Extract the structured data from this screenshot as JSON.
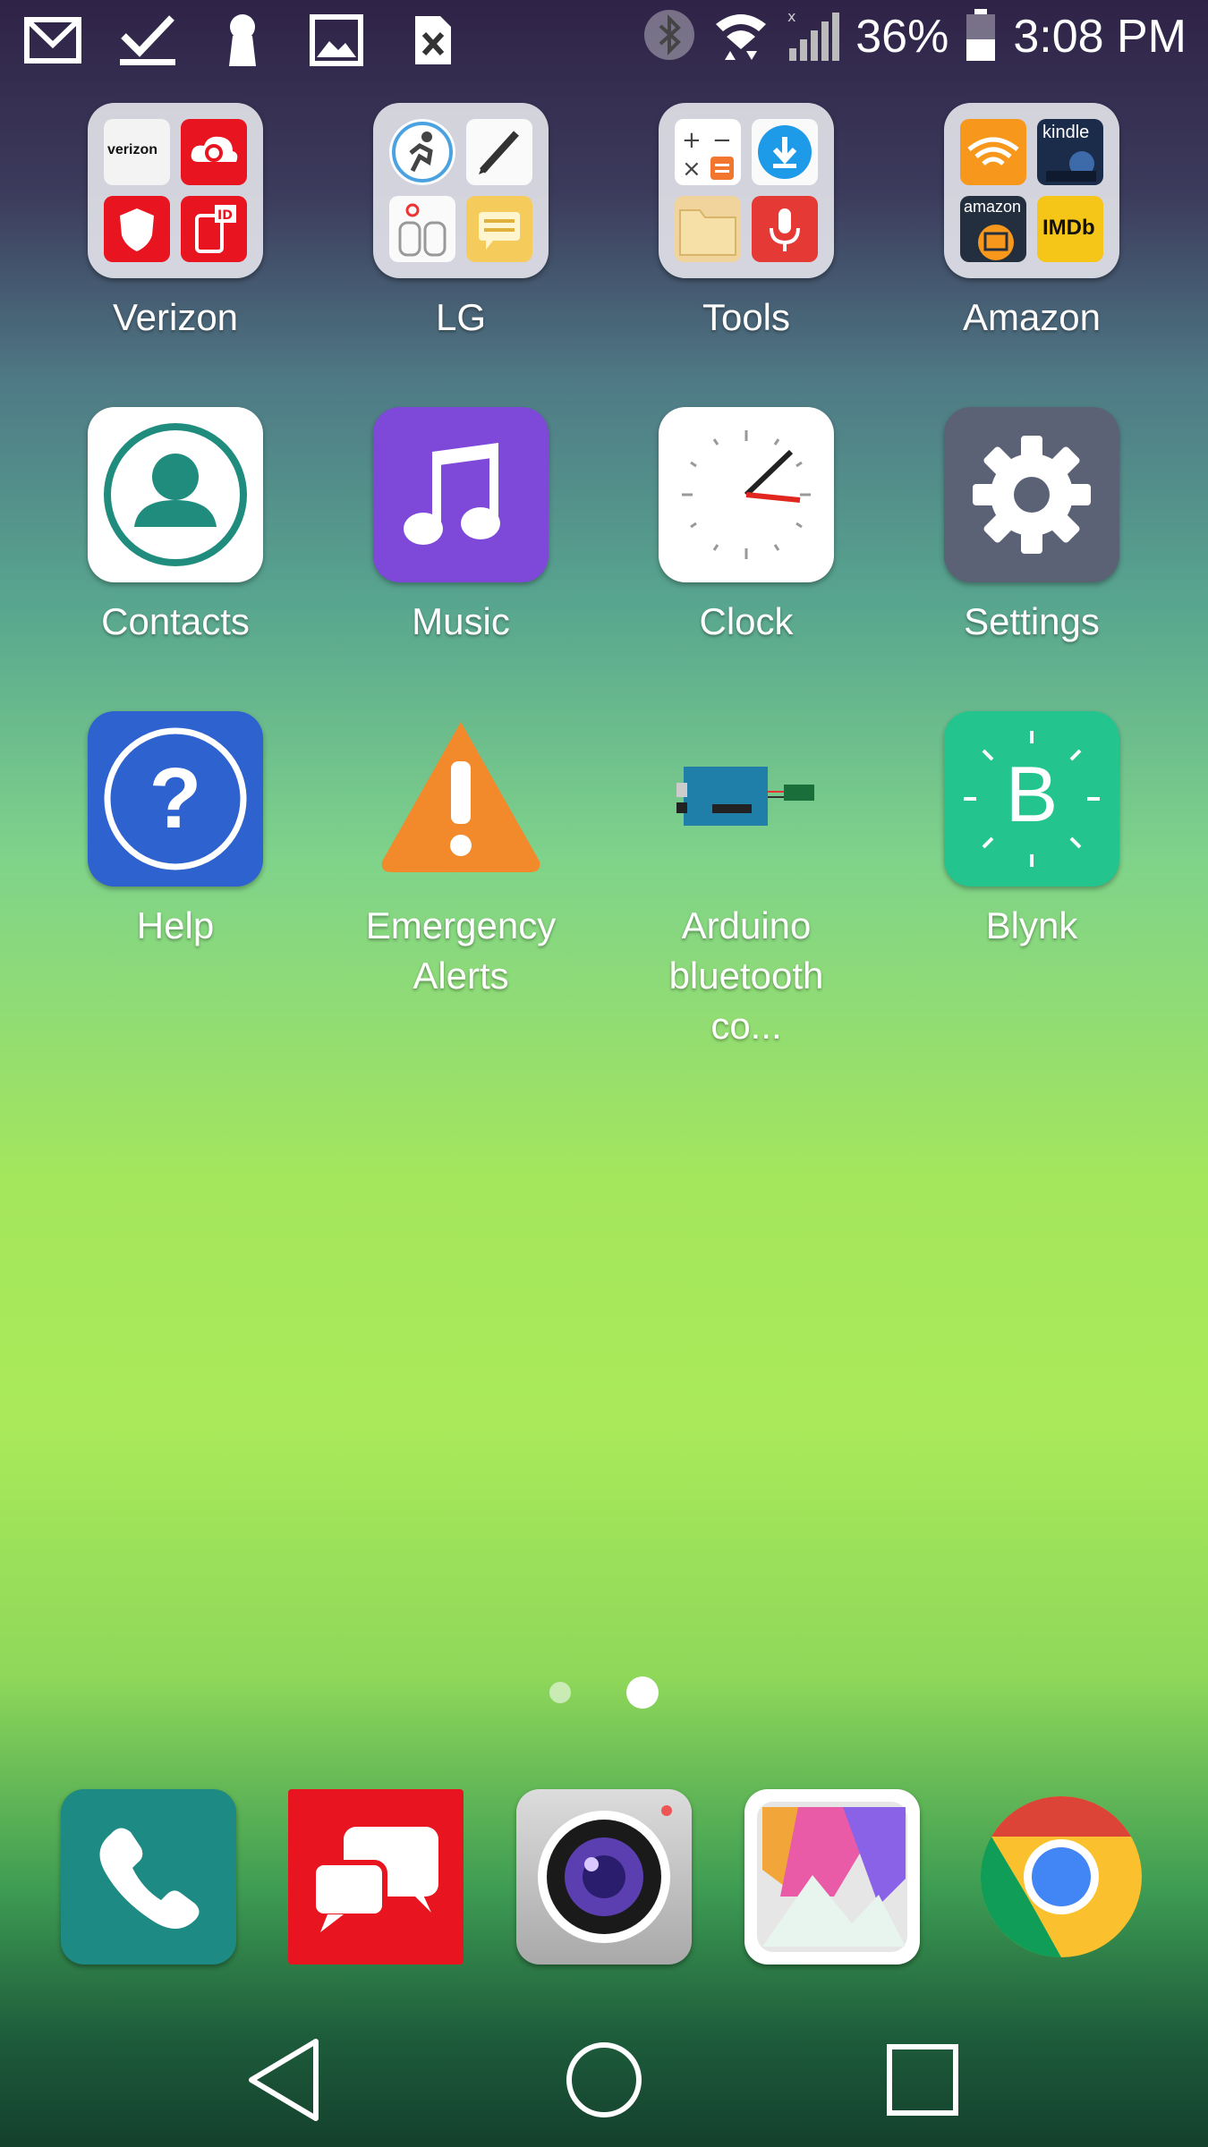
{
  "status_bar": {
    "left_icons": [
      "gmail-icon",
      "checkmark-icon",
      "keyhole-icon",
      "gallery-icon",
      "sim-error-icon"
    ],
    "battery_percent": "36%",
    "time": "3:08 PM"
  },
  "apps": [
    {
      "label": "Verizon",
      "name": "verizon-folder"
    },
    {
      "label": "LG",
      "name": "lg-folder"
    },
    {
      "label": "Tools",
      "name": "tools-folder"
    },
    {
      "label": "Amazon",
      "name": "amazon-folder"
    },
    {
      "label": "Contacts",
      "name": "contacts-app"
    },
    {
      "label": "Music",
      "name": "music-app"
    },
    {
      "label": "Clock",
      "name": "clock-app"
    },
    {
      "label": "Settings",
      "name": "settings-app"
    },
    {
      "label": "Help",
      "name": "help-app"
    },
    {
      "label": "Emergency Alerts",
      "name": "emergency-alerts-app"
    },
    {
      "label": "Arduino bluetooth co...",
      "name": "arduino-bluetooth-app"
    },
    {
      "label": "Blynk",
      "name": "blynk-app"
    }
  ],
  "folder_text": {
    "verizon": "verizon",
    "kindle": "kindle",
    "amazon": "amazon",
    "imdb": "IMDb",
    "blynk_letter": "B"
  },
  "page_indicator": {
    "pages": 2,
    "current": 2
  },
  "dock": [
    "phone-app",
    "messages-app",
    "camera-app",
    "gallery-app",
    "chrome-app"
  ],
  "nav": [
    "back-button",
    "home-button",
    "recents-button"
  ],
  "colors": {
    "verizon_red": "#e8141f",
    "music_purple": "#7e49d8",
    "settings_gray": "#5c6275",
    "help_blue": "#2e62cf",
    "alert_orange": "#f28a2b",
    "blynk_green": "#23c48e",
    "phone_teal": "#1d8a83"
  }
}
